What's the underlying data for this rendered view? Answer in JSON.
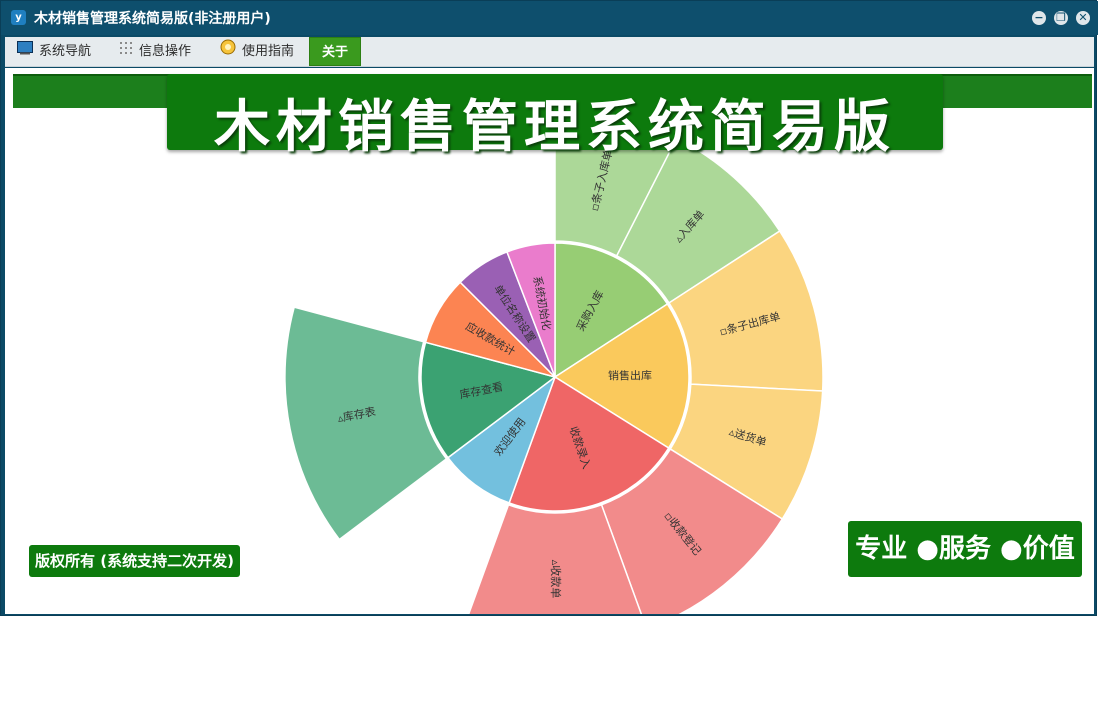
{
  "window": {
    "title": "木材销售管理系统简易版(非注册用户)",
    "app_icon": "y",
    "controls": {
      "minimize": "−",
      "restore": "❐",
      "close": "✕"
    }
  },
  "menu": {
    "items": [
      {
        "label": "系统导航",
        "icon": "monitor-icon"
      },
      {
        "label": "信息操作",
        "icon": "grid-icon"
      },
      {
        "label": "使用指南",
        "icon": "help-icon"
      },
      {
        "label": "关于",
        "icon": "",
        "active": true
      }
    ]
  },
  "banner": {
    "title": "木材销售管理系统简易版"
  },
  "footer": {
    "copyright": "版权所有 (系统支持二次开发)",
    "slogan": "专业 ●服务 ●价值"
  },
  "colors": {
    "banner_green": "#0d7a0d",
    "titlebar": "#0e4f6d",
    "menu_active": "#3a9a1e"
  },
  "sunburst": {
    "inner": [
      {
        "label": "采购入库",
        "color": "#97cd74"
      },
      {
        "label": "销售出库",
        "color": "#fac95c"
      },
      {
        "label": "收款录入",
        "color": "#ef6666"
      },
      {
        "label": "欢迎使用",
        "color": "#73c0de"
      },
      {
        "label": "库存查看",
        "color": "#3ba272"
      },
      {
        "label": "应收款统计",
        "color": "#fc8452"
      },
      {
        "label": "单位名称设置",
        "color": "#9a60b4"
      },
      {
        "label": "系统初始化",
        "color": "#ea7ccc"
      }
    ],
    "outer": [
      {
        "label": "▫条子入库单",
        "parent": 0,
        "color": "#acd898"
      },
      {
        "label": "▵入库单",
        "parent": 0,
        "color": "#acd898"
      },
      {
        "label": "▫条子出库单",
        "parent": 1,
        "color": "#fbd580"
      },
      {
        "label": "▵送货单",
        "parent": 1,
        "color": "#fbd580"
      },
      {
        "label": "▫收款登记",
        "parent": 2,
        "color": "#f28b8b"
      },
      {
        "label": "▵收款单",
        "parent": 2,
        "color": "#f28b8b"
      },
      {
        "label": "▵库存表",
        "parent": 4,
        "color": "#6cbb95"
      }
    ]
  }
}
